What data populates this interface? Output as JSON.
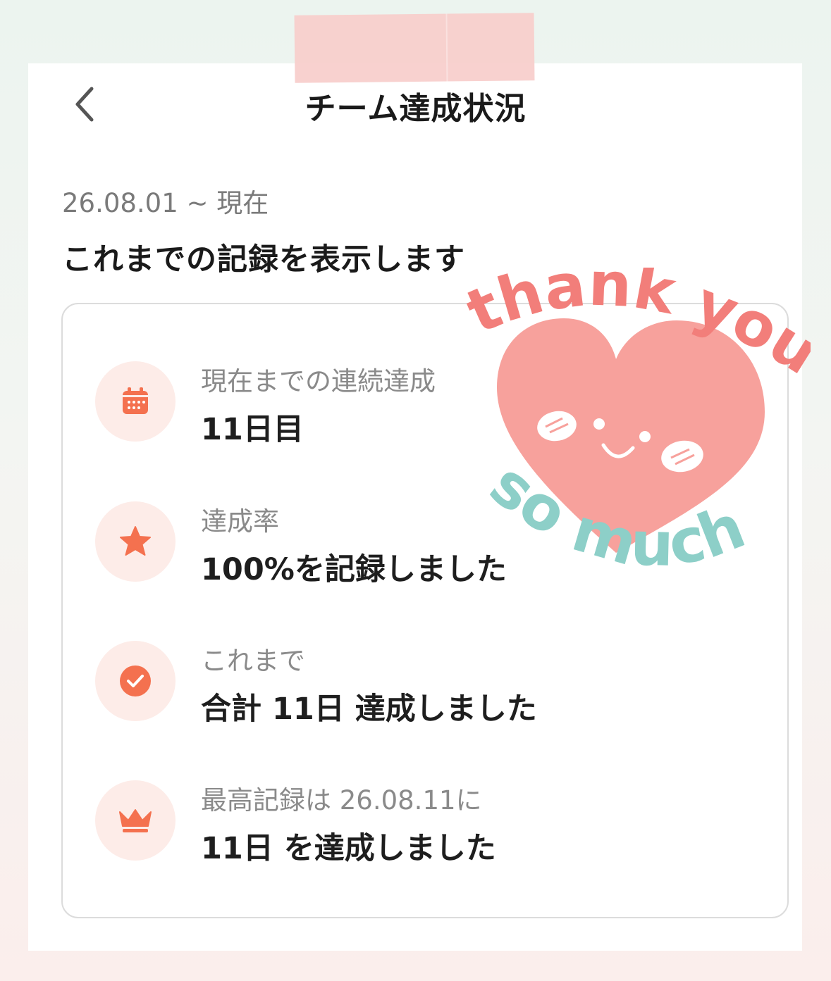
{
  "header": {
    "title": "チーム達成状況",
    "back_icon": "chevron-left-icon"
  },
  "summary": {
    "date_range": "26.08.01 ~ 現在",
    "description": "これまでの記録を表示します"
  },
  "stats": [
    {
      "icon": "calendar-icon",
      "label": "現在までの連続達成",
      "value": "11日目"
    },
    {
      "icon": "star-icon",
      "label": "達成率",
      "value": "100%を記録しました"
    },
    {
      "icon": "check-circle-icon",
      "label": "これまで",
      "value": "合計 11日 達成しました"
    },
    {
      "icon": "crown-icon",
      "label": "最高記録は 26.08.11に",
      "value": "11日 を達成しました"
    }
  ],
  "sticker": {
    "line1": "thank you",
    "line2": "so much"
  },
  "colors": {
    "accent": "#f4714f",
    "icon_bg": "#fdece8",
    "heart": "#f7a19c",
    "sticker_pink": "#f27e7a",
    "sticker_teal": "#8dcfc8"
  }
}
